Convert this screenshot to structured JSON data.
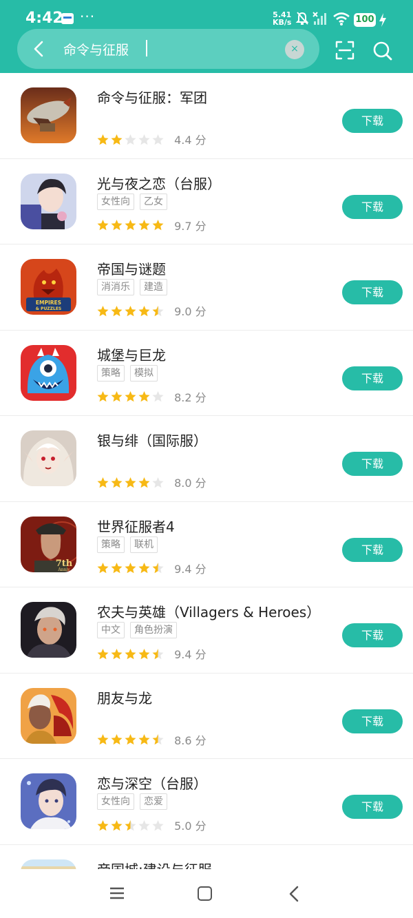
{
  "status_bar": {
    "time": "4:42",
    "more": "···",
    "speed_value": "5.41",
    "speed_unit": "KB/s",
    "battery": "100"
  },
  "search": {
    "query": "命令与征服",
    "clear_label": "×"
  },
  "colors": {
    "accent": "#27bca7",
    "star_on": "#f7b915",
    "star_off": "#e6e6e6"
  },
  "apps": [
    {
      "name": "命令与征服：军团",
      "tags": [],
      "stars": 2,
      "score": "4.4 分",
      "button": "下载",
      "icon": "airship-icon"
    },
    {
      "name": "光与夜之恋（台服）",
      "tags": [
        "女性向",
        "乙女"
      ],
      "stars": 5,
      "score": "9.7 分",
      "button": "下载",
      "icon": "anime-boy-icon"
    },
    {
      "name": "帝国与谜题",
      "tags": [
        "消消乐",
        "建造"
      ],
      "stars": 4.5,
      "score": "9.0 分",
      "button": "下载",
      "icon": "dragon-icon",
      "icon_text": "EMPIRES & PUZZLES"
    },
    {
      "name": "城堡与巨龙",
      "tags": [
        "策略",
        "模拟"
      ],
      "stars": 4,
      "score": "8.2 分",
      "button": "下载",
      "icon": "blue-monster-icon"
    },
    {
      "name": "银与绯（国际服）",
      "tags": [],
      "stars": 4,
      "score": "8.0 分",
      "button": "下载",
      "icon": "vampire-girl-icon"
    },
    {
      "name": "世界征服者4",
      "tags": [
        "策略",
        "联机"
      ],
      "stars": 4.5,
      "score": "9.4 分",
      "button": "下载",
      "icon": "general-icon",
      "icon_text": "7th Anniv"
    },
    {
      "name": "农夫与英雄（Villagers & Heroes）",
      "tags": [
        "中文",
        "角色扮演"
      ],
      "stars": 4.5,
      "score": "9.4 分",
      "button": "下载",
      "icon": "hero-icon"
    },
    {
      "name": "朋友与龙",
      "tags": [],
      "stars": 4.5,
      "score": "8.6 分",
      "button": "下载",
      "icon": "elf-dragon-icon"
    },
    {
      "name": "恋与深空（台服）",
      "tags": [
        "女性向",
        "恋爱"
      ],
      "stars": 2.5,
      "score": "5.0 分",
      "button": "下载",
      "icon": "anime-boy2-icon"
    },
    {
      "name": "帝国城:建设与征服",
      "tags": [],
      "stars": 0,
      "score": "",
      "button": "",
      "icon": "city-icon"
    }
  ]
}
